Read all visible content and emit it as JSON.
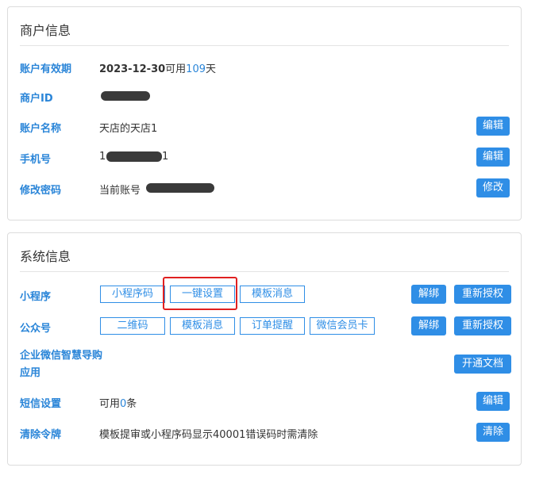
{
  "merchant": {
    "title": "商户信息",
    "expiry_label": "账户有效期",
    "expiry_date": "2023-12-30",
    "expiry_available_prefix": "可用",
    "expiry_days": "109",
    "expiry_suffix": "天",
    "id_label": "商户ID",
    "id_value_visible": "",
    "name_label": "账户名称",
    "name_value": "天店的天店1",
    "name_edit": "编辑",
    "phone_label": "手机号",
    "phone_prefix": "1",
    "phone_suffix": "1",
    "phone_edit": "编辑",
    "password_label": "修改密码",
    "password_value_prefix": "当前账号",
    "password_modify": "修改"
  },
  "system": {
    "title": "系统信息",
    "miniapp_label": "小程序",
    "miniapp_buttons": [
      "小程序码",
      "一键设置",
      "模板消息"
    ],
    "miniapp_unbind": "解绑",
    "miniapp_reauth": "重新授权",
    "official_label": "公众号",
    "official_buttons": [
      "二维码",
      "模板消息",
      "订单提醒",
      "微信会员卡"
    ],
    "official_unbind": "解绑",
    "official_reauth": "重新授权",
    "wecom_label": "企业微信智慧导购应用",
    "wecom_doc": "开通文档",
    "sms_label": "短信设置",
    "sms_prefix": "可用",
    "sms_count": "0",
    "sms_suffix": "条",
    "sms_edit": "编辑",
    "token_label": "清除令牌",
    "token_desc": "模板提审或小程序码显示40001错误码时需清除",
    "token_clear": "清除"
  },
  "colors": {
    "accent": "#2f8ee6",
    "label": "#2a85d8",
    "highlight": "#e02020"
  }
}
